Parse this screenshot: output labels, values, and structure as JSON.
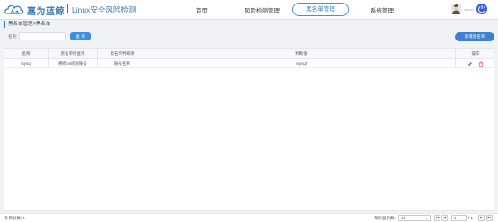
{
  "header": {
    "brand": "嘉为蓝鲸",
    "subtitle": "Linux安全风险检测",
    "nav": [
      {
        "label": "首页"
      },
      {
        "label": "风险检测管理"
      },
      {
        "label": "黑名单管理"
      },
      {
        "label": "系统管理"
      }
    ],
    "active_nav": "黑名单管理",
    "username": "admin",
    "brand_color": "#3a79b5",
    "accent_color": "#3d8ee3"
  },
  "breadcrumb": "黑名单管理>黑名单",
  "filter": {
    "label": "名称:",
    "value": "",
    "placeholder": "",
    "query_label": "查 询",
    "add_label": "新增黑名单"
  },
  "table": {
    "columns": [
      "名称",
      "黑名单检查项",
      "黑名单判断项",
      "判断值",
      "操作"
    ],
    "rows": [
      {
        "name": "mysql",
        "check_item": "拥有ps权限账号",
        "judge_item": "账号名称",
        "value": "mysql",
        "actions": [
          "edit-icon",
          "delete-icon"
        ]
      }
    ]
  },
  "footer": {
    "total_label": "条目总数:",
    "total_value": "1",
    "per_page_label": "每页显示数:",
    "per_page_value": "10",
    "current_page": "1",
    "page_of": "/ 1"
  }
}
